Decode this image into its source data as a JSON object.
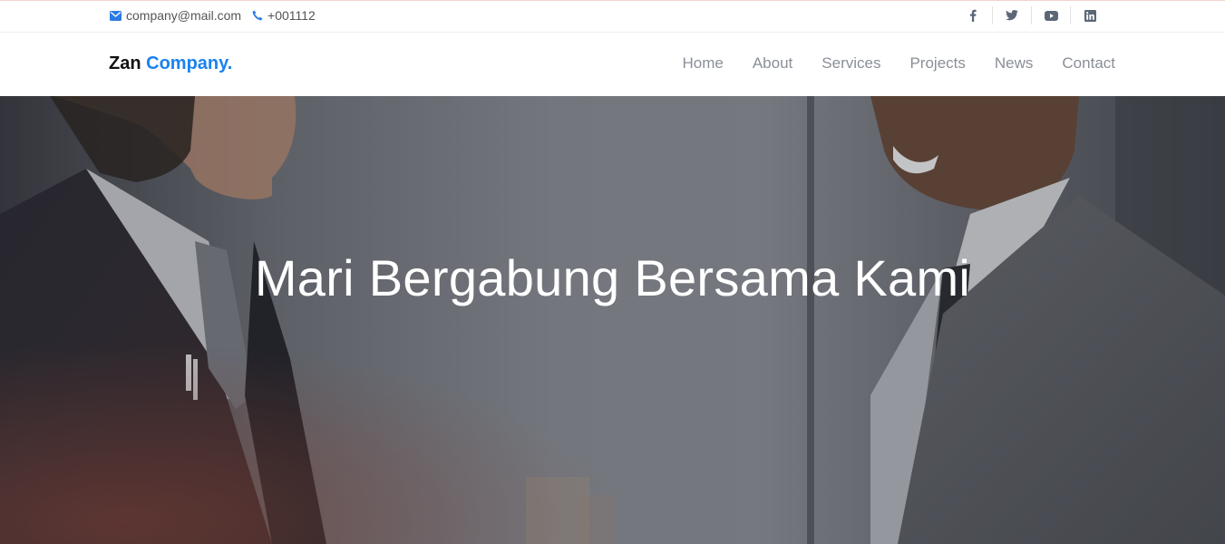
{
  "topbar": {
    "email": "company@mail.com",
    "phone": "+001112",
    "social": [
      {
        "icon": "facebook-icon"
      },
      {
        "icon": "twitter-icon"
      },
      {
        "icon": "youtube-icon"
      },
      {
        "icon": "linkedin-icon"
      }
    ]
  },
  "brand": {
    "name": "Zan",
    "accent": "Company."
  },
  "nav": {
    "items": [
      "Home",
      "About",
      "Services",
      "Projects",
      "News",
      "Contact"
    ]
  },
  "hero": {
    "title": "Mari Bergabung Bersama Kami"
  },
  "colors": {
    "accent": "#1a82f0",
    "nav_text": "#8a8f96",
    "icon": "#5b6777"
  }
}
